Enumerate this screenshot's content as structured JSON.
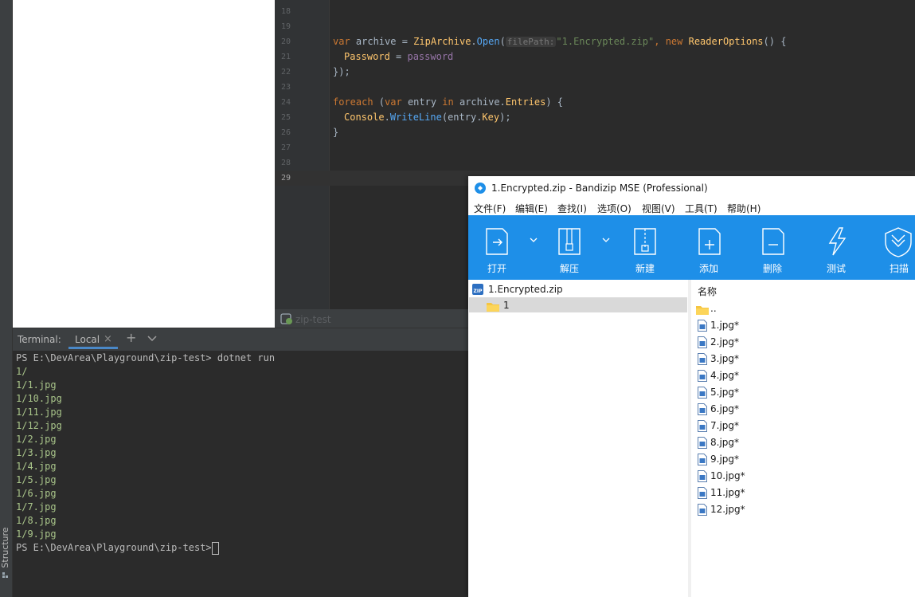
{
  "ide": {
    "structure_label": "Structure",
    "line_numbers": [
      "18",
      "19",
      "20",
      "21",
      "22",
      "23",
      "24",
      "25",
      "26",
      "27",
      "28",
      "29"
    ],
    "code": {
      "l20": {
        "kw1": "var",
        "ident1": " archive = ",
        "fn1": "ZipArchive",
        "dot1": ".",
        "method1": "Open",
        "p1": "(",
        "hint": "filePath:",
        "str1": "\"1.Encrypted.zip\"",
        "comma": ", ",
        "kw2": "new",
        "sp": " ",
        "fn2": "ReaderOptions",
        "end": "() {"
      },
      "l21": {
        "prop": "Password",
        "rest": " = ",
        "ident": "password"
      },
      "l22": {
        "text": "});"
      },
      "l24": {
        "kw1": "foreach",
        "p1": " (",
        "kw2": "var",
        "ident1": " entry ",
        "kw3": "in",
        "ident2": " archive.",
        "prop": "Entries",
        "end": ") {"
      },
      "l25": {
        "fn": "Console",
        "dot": ".",
        "method": "WriteLine",
        "args": "(entry.",
        "prop": "Key",
        "end": ");"
      },
      "l26": {
        "text": "}"
      }
    },
    "breadcrumb": "zip-test"
  },
  "terminal": {
    "title": "Terminal:",
    "tab_label": "Local",
    "close_glyph": "×",
    "plus_glyph": "+",
    "lines": [
      "PS E:\\DevArea\\Playground\\zip-test> dotnet run",
      "1/",
      "1/1.jpg",
      "1/10.jpg",
      "1/11.jpg",
      "1/12.jpg",
      "1/2.jpg",
      "1/3.jpg",
      "1/4.jpg",
      "1/5.jpg",
      "1/6.jpg",
      "1/7.jpg",
      "1/8.jpg",
      "1/9.jpg",
      "PS E:\\DevArea\\Playground\\zip-test> "
    ]
  },
  "bandizip": {
    "title": "1.Encrypted.zip - Bandizip MSE (Professional)",
    "menu": [
      "文件(F)",
      "编辑(E)",
      "查找(I)",
      "选项(O)",
      "视图(V)",
      "工具(T)",
      "帮助(H)"
    ],
    "toolbar": [
      "打开",
      "解压",
      "新建",
      "添加",
      "删除",
      "测试",
      "扫描"
    ],
    "tree": {
      "root": "1.Encrypted.zip",
      "folder": "1"
    },
    "list_header": "名称",
    "files": [
      "..",
      "1.jpg*",
      "2.jpg*",
      "3.jpg*",
      "4.jpg*",
      "5.jpg*",
      "6.jpg*",
      "7.jpg*",
      "8.jpg*",
      "9.jpg*",
      "10.jpg*",
      "11.jpg*",
      "12.jpg*"
    ],
    "colors": {
      "toolbar": "#1e8fe8",
      "selection": "#d9d9d9"
    }
  }
}
